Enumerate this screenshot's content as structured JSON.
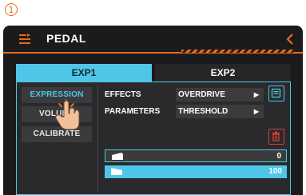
{
  "step_marker": "1",
  "header": {
    "title": "PEDAL",
    "menu_icon": "list-icon",
    "back_icon": "chevron-left-icon"
  },
  "tabs": [
    {
      "label": "EXP1",
      "active": true
    },
    {
      "label": "EXP2",
      "active": false
    }
  ],
  "sidebar": {
    "items": [
      {
        "label": "EXPRESSION",
        "selected": true
      },
      {
        "label": "VOLUME",
        "selected": false
      },
      {
        "label": "CALIBRATE",
        "selected": false
      }
    ]
  },
  "params": {
    "effects_label": "EFFECTS",
    "effects_value": "OVERDRIVE",
    "parameters_label": "PARAMETERS",
    "parameters_value": "THRESHOLD"
  },
  "range": {
    "min_value": "0",
    "max_value": "100"
  },
  "colors": {
    "accent": "#4fc6e8",
    "brand": "#e86a1a",
    "delete": "#e23a3a",
    "background": "#1b1b1d"
  }
}
